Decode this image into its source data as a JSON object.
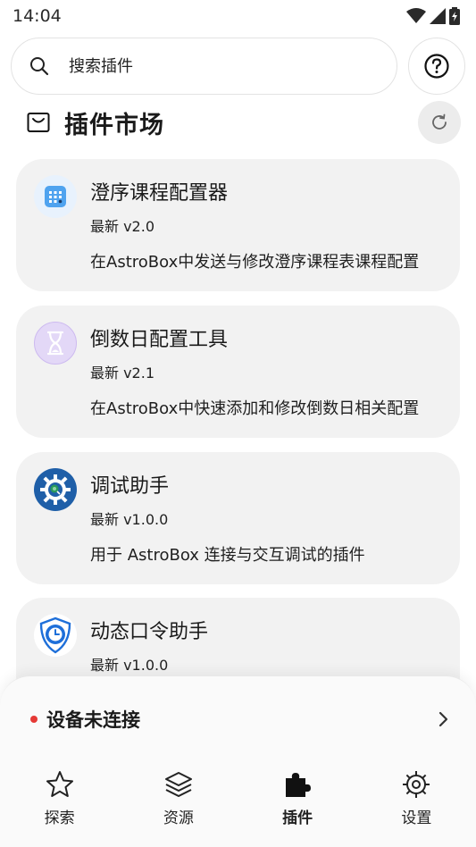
{
  "status": {
    "time": "14:04"
  },
  "search": {
    "placeholder": "搜索插件"
  },
  "section": {
    "title": "插件市场"
  },
  "plugins": [
    {
      "name": "澄序课程配置器",
      "version": "最新 v2.0",
      "description": "在AstroBox中发送与修改澄序课程表课程配置"
    },
    {
      "name": "倒数日配置工具",
      "version": "最新 v2.1",
      "description": "在AstroBox中快速添加和修改倒数日相关配置"
    },
    {
      "name": "调试助手",
      "version": "最新 v1.0.0",
      "description": "用于 AstroBox 连接与交互调试的插件"
    },
    {
      "name": "动态口令助手",
      "version": "最新 v1.0.0",
      "description": ""
    }
  ],
  "device": {
    "status": "设备未连接"
  },
  "nav": [
    {
      "label": "探索",
      "icon": "star-icon"
    },
    {
      "label": "资源",
      "icon": "layers-icon"
    },
    {
      "label": "插件",
      "icon": "puzzle-icon"
    },
    {
      "label": "设置",
      "icon": "gear-icon"
    }
  ],
  "colors": {
    "card": "#f2f2f2",
    "status_dot": "#e53935",
    "accent_blue": "#1e6fd9"
  }
}
